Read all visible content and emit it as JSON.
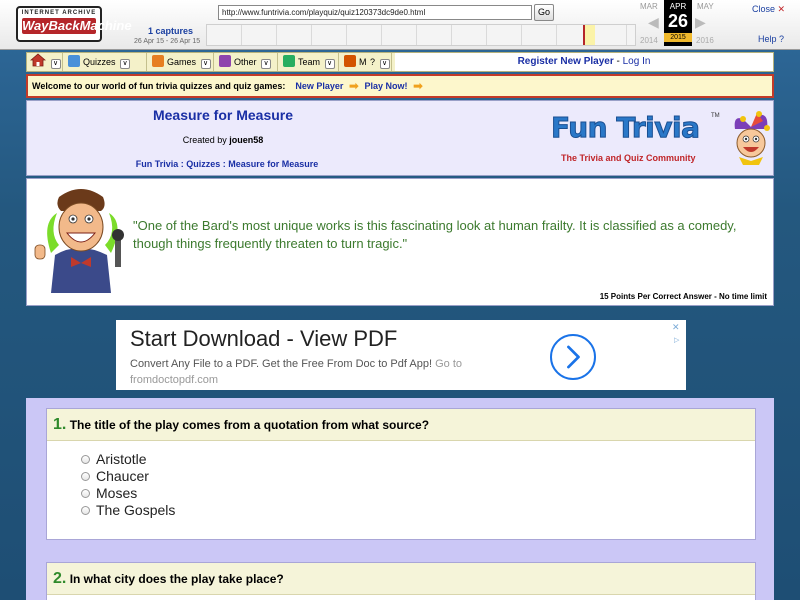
{
  "wayback": {
    "logo_top": "INTERNET ARCHIVE",
    "logo_main": "WayBackMachine",
    "url": "http://www.funtrivia.com/playquiz/quiz120373dc9de0.html",
    "go_label": "Go",
    "captures": "1 captures",
    "range": "26 Apr 15 - 26 Apr 15",
    "prev_month": "MAR",
    "cur_month": "APR",
    "next_month": "MAY",
    "day": "26",
    "prev_year": "2014",
    "cur_year": "2015",
    "next_year": "2016",
    "close_label": "Close",
    "help_label": "Help"
  },
  "nav": {
    "items": [
      {
        "label": "Quizzes",
        "icon": "quizzes-icon"
      },
      {
        "label": "Games",
        "icon": "games-icon"
      },
      {
        "label": "Other",
        "icon": "other-icon"
      },
      {
        "label": "Team",
        "icon": "team-icon"
      },
      {
        "label": "Me",
        "icon": "me-icon"
      },
      {
        "label": "?",
        "icon": ""
      }
    ],
    "register": "Register New Player",
    "separator": " - ",
    "login": "Log In"
  },
  "welcome": {
    "text": "Welcome to our world of fun trivia quizzes and quiz games:",
    "new_player": "New Player",
    "play_now": "Play Now!"
  },
  "quiz": {
    "title": "Measure for Measure",
    "created_by_prefix": "Created by",
    "author": "jouen58",
    "breadcrumb_1": "Fun Trivia",
    "breadcrumb_sep": " : ",
    "breadcrumb_2": "Quizzes",
    "breadcrumb_3": "Measure for Measure",
    "description": "\"One of the Bard's most unique works is this fascinating look at human frailty. It is classified as a comedy, though things frequently threaten to turn tragic.\"",
    "points": "15 Points Per Correct Answer - No time limit"
  },
  "brand": {
    "name": "Fun Trivia",
    "tm": "TM",
    "tagline": "The Trivia and Quiz Community"
  },
  "ad": {
    "title": "Start Download - View PDF",
    "body": "Convert Any File to a PDF. Get the Free From Doc to Pdf App!",
    "goto": "Go to fromdoctopdf.com"
  },
  "questions": [
    {
      "number": "1.",
      "text": "The title of the play comes from a quotation from what source?",
      "options": [
        "Aristotle",
        "Chaucer",
        "Moses",
        "The Gospels"
      ]
    },
    {
      "number": "2.",
      "text": "In what city does the play take place?",
      "options": []
    }
  ],
  "colors": {
    "page_bg": "#24587f",
    "link": "#1a2fa5",
    "question_number": "#2f8a2b",
    "description_text": "#3c7a2e",
    "welcome_border": "#c43b28"
  }
}
